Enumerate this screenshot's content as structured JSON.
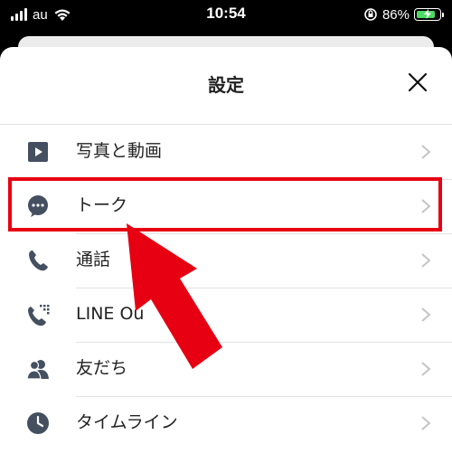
{
  "status": {
    "carrier": "au",
    "time": "10:54",
    "battery_percent": "86%",
    "battery_level": 0.86,
    "colors": {
      "battery": "#4cd964"
    }
  },
  "header": {
    "title": "設定"
  },
  "items": [
    {
      "label": "写真と動画",
      "icon": "play-icon"
    },
    {
      "label": "トーク",
      "icon": "chat-bubble-icon"
    },
    {
      "label": "通話",
      "icon": "phone-icon"
    },
    {
      "label": "LINE Ou",
      "icon": "phone-keypad-icon"
    },
    {
      "label": "友だち",
      "icon": "friends-icon"
    },
    {
      "label": "タイムライン",
      "icon": "clock-icon"
    }
  ],
  "annotation": {
    "highlighted_item": "トーク",
    "color": "#e60012"
  }
}
